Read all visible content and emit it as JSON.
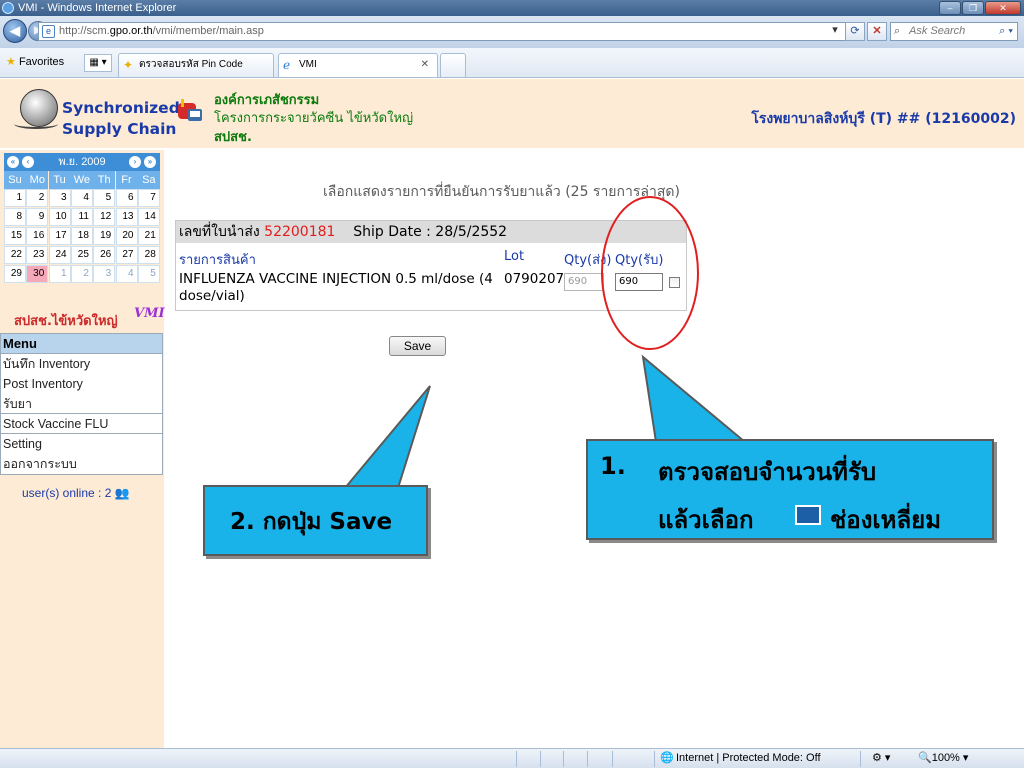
{
  "window": {
    "title": "VMI - Windows Internet Explorer"
  },
  "address": {
    "url_prefix": "http://scm.",
    "url_host": "gpo.or.th",
    "url_path": "/vmi/member/main.asp",
    "search_placeholder": "Ask Search"
  },
  "favorites": {
    "label": "Favorites",
    "tab1": "ตรวจสอบรหัส Pin Code",
    "tab2": "VMI"
  },
  "header": {
    "brand_line1": "Synchronized",
    "brand_line2": "Supply Chain",
    "org_name": "องค์การเภสัชกรรม",
    "org_project": "โครงการกระจายวัคซีน ไข้หวัดใหญ่",
    "org_dept": "สปสช.",
    "hospital": "โรงพยาบาลสิงห์บุรี (T) ## (12160002)"
  },
  "calendar": {
    "month_year": "พ.ย. 2009",
    "dow": [
      "Su",
      "Mo",
      "Tu",
      "We",
      "Th",
      "Fr",
      "Sa"
    ],
    "weeks": [
      [
        "1",
        "2",
        "3",
        "4",
        "5",
        "6",
        "7"
      ],
      [
        "8",
        "9",
        "10",
        "11",
        "12",
        "13",
        "14"
      ],
      [
        "15",
        "16",
        "17",
        "18",
        "19",
        "20",
        "21"
      ],
      [
        "22",
        "23",
        "24",
        "25",
        "26",
        "27",
        "28"
      ],
      [
        "29",
        "30",
        "1",
        "2",
        "3",
        "4",
        "5"
      ]
    ],
    "today": "30"
  },
  "sidebar": {
    "region_label": "สปสช.ไข้หวัดใหญ่",
    "vmi_mark": "VMI",
    "menu_title": "Menu",
    "menu_items": [
      "บันทึก Inventory",
      "Post Inventory",
      "รับยา",
      "Stock Vaccine FLU",
      "Setting",
      "ออกจากระบบ"
    ],
    "online_label": "user(s) online : 2"
  },
  "main": {
    "heading": "เลือกแสดงรายการที่ยืนยันการรับยาแล้ว (25 รายการล่าสุด)",
    "ship_label": "เลขที่ใบนำส่ง",
    "ship_no": "52200181",
    "ship_date": "Ship Date : 28/5/2552",
    "col_item": "รายการสินค้า",
    "col_lot": "Lot",
    "col_qty_sent": "Qty(ส่ง)",
    "col_qty_recv": "Qty(รับ)",
    "product": "INFLUENZA VACCINE INJECTION 0.5 ml/dose (4 dose/vial)",
    "lot": "0790207",
    "qty_sent": "690",
    "qty_recv": "690",
    "save_label": "Save"
  },
  "callouts": {
    "c1_num": "1.",
    "c1_line1": "ตรวจสอบจำนวนที่รับ",
    "c1_line2a": "แล้วเลือก",
    "c1_line2b": "ช่องเหลี่ยม",
    "c2_text": "2. กดปุ่ม Save"
  },
  "status": {
    "zone": "Internet | Protected Mode: Off",
    "zoom": "100%"
  },
  "colors": {
    "callout_fill": "#19b3ea",
    "highlight_ring": "#e02020",
    "brand_blue": "#1a3aa8",
    "org_green": "#0d7a0d"
  }
}
